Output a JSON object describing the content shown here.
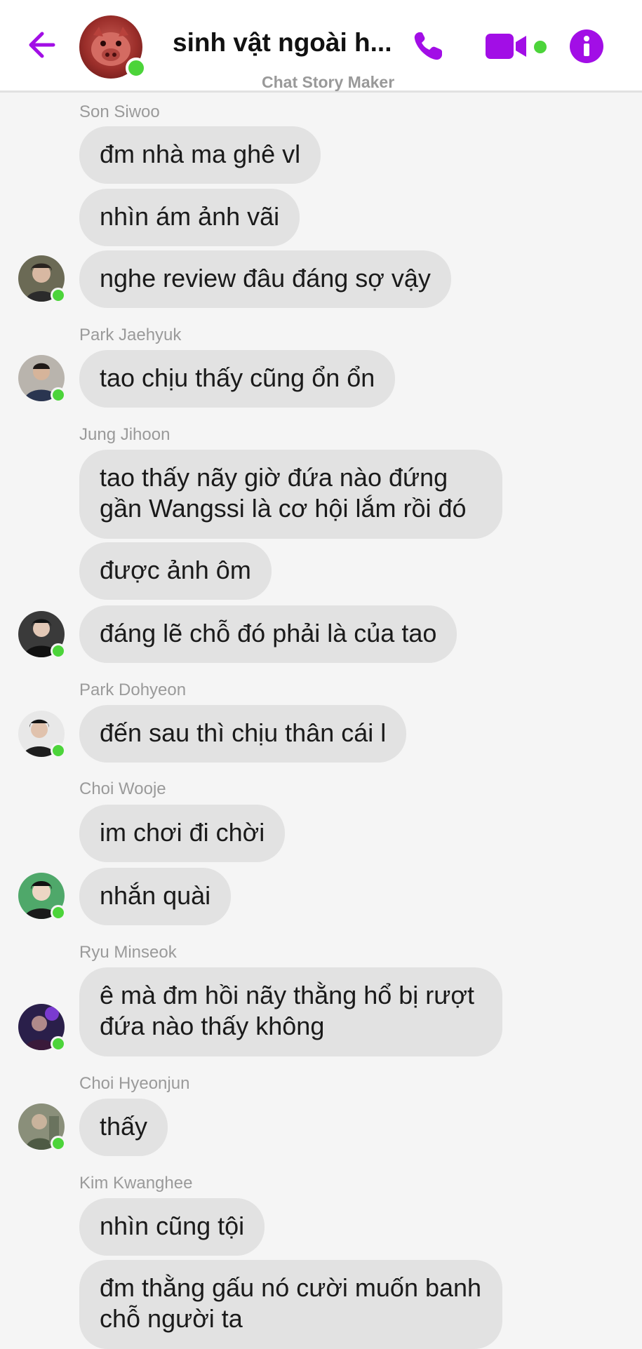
{
  "header": {
    "title": "sinh vật ngoài h...",
    "subtitle": "Chat Story Maker",
    "accent_color": "#a20ee6",
    "online_color": "#4cd43a",
    "icons": [
      "back-arrow-icon",
      "phone-icon",
      "video-camera-icon",
      "info-icon"
    ]
  },
  "messages": {
    "g1": {
      "name": "Son Siwoo",
      "m1": "đm nhà ma ghê vl",
      "m2": "nhìn ám ảnh vãi",
      "m3": "nghe review đâu đáng sợ vậy"
    },
    "g2": {
      "name": "Park Jaehyuk",
      "m1": "tao chịu thấy cũng ổn ổn"
    },
    "g3": {
      "name": "Jung Jihoon",
      "m1": "tao thấy nãy giờ đứa nào đứng gần Wangssi là cơ hội lắm rồi đó",
      "m2": "được ảnh ôm",
      "m3": "đáng lẽ chỗ đó phải là của tao"
    },
    "g4": {
      "name": "Park Dohyeon",
      "m1": "đến sau thì chịu thân cái l"
    },
    "g5": {
      "name": "Choi Wooje",
      "m1": "im chơi đi chời",
      "m2": "nhắn quài"
    },
    "g6": {
      "name": "Ryu Minseok",
      "m1": "ê mà đm hồi nãy thằng hổ bị rượt đứa nào thấy không"
    },
    "g7": {
      "name": "Choi Hyeonjun",
      "m1": "thấy"
    },
    "g8": {
      "name": "Kim Kwanghee",
      "m1": "nhìn cũng tội",
      "m2": "đm thằng gấu nó cười muốn banh chỗ người ta"
    }
  }
}
